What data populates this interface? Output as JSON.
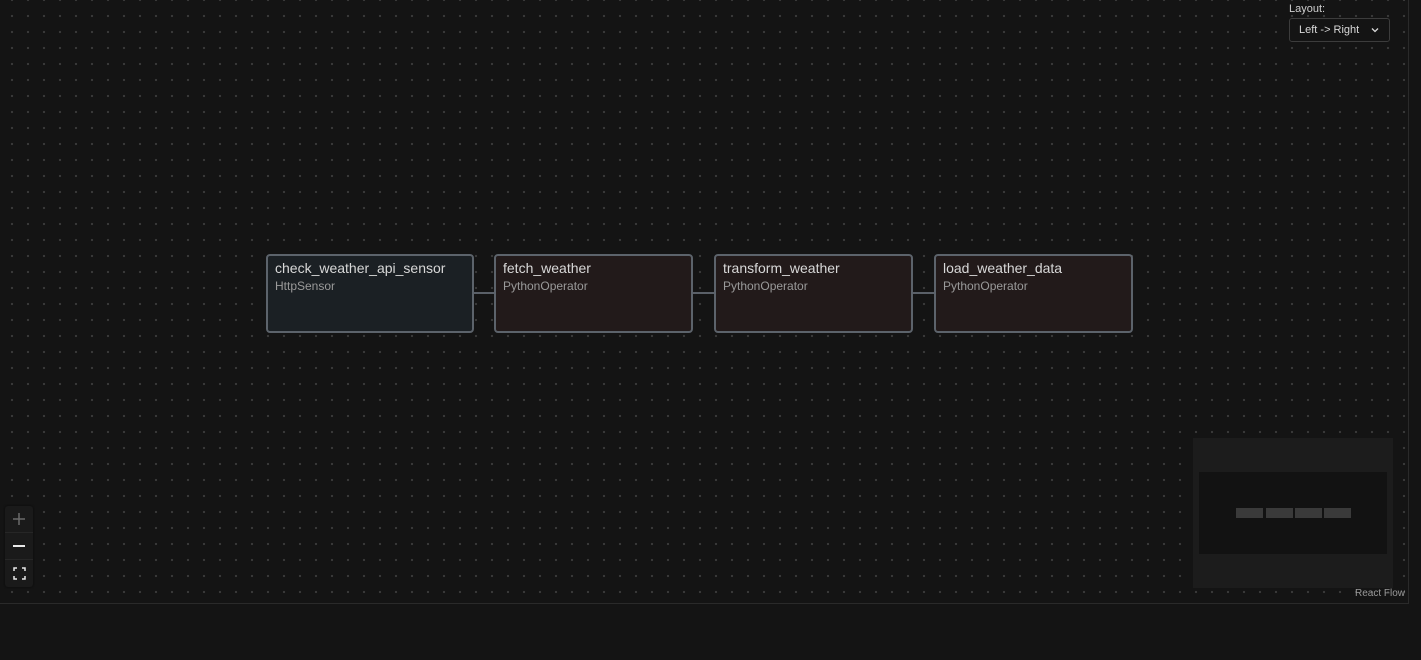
{
  "layout_control": {
    "label": "Layout:",
    "selected": "Left -> Right"
  },
  "nodes": [
    {
      "title": "check_weather_api_sensor",
      "type": "HttpSensor"
    },
    {
      "title": "fetch_weather",
      "type": "PythonOperator"
    },
    {
      "title": "transform_weather",
      "type": "PythonOperator"
    },
    {
      "title": "load_weather_data",
      "type": "PythonOperator"
    }
  ],
  "controls": {
    "zoom_in_icon": "plus-icon",
    "zoom_out_icon": "minus-icon",
    "fit_view_icon": "fit-view-icon"
  },
  "attribution": "React Flow",
  "colors": {
    "background": "#141414",
    "sensor_node": "#1b2024",
    "operator_node": "#221a1a",
    "node_border": "#5c636b"
  }
}
